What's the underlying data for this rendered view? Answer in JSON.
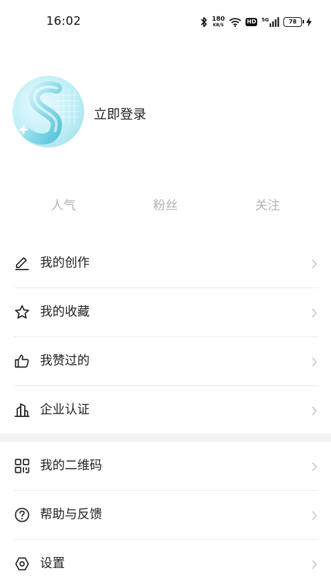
{
  "status_bar": {
    "time": "16:02",
    "net_speed_value": "180",
    "net_speed_unit": "KB/S",
    "hd": "HD",
    "signal_type": "5G",
    "battery": "78",
    "icons": [
      "bluetooth-icon",
      "wifi-icon",
      "hd-icon",
      "cell-signal-icon",
      "battery-icon",
      "charging-icon"
    ]
  },
  "profile": {
    "login_label": "立即登录"
  },
  "stats": [
    {
      "label": "人气"
    },
    {
      "label": "粉丝"
    },
    {
      "label": "关注"
    }
  ],
  "menu_primary": [
    {
      "label": "我的创作",
      "icon": "pencil-icon"
    },
    {
      "label": "我的收藏",
      "icon": "star-icon"
    },
    {
      "label": "我赞过的",
      "icon": "thumbs-up-icon"
    },
    {
      "label": "企业认证",
      "icon": "building-icon"
    }
  ],
  "menu_secondary": [
    {
      "label": "我的二维码",
      "icon": "qr-code-icon"
    },
    {
      "label": "帮助与反馈",
      "icon": "help-icon"
    },
    {
      "label": "设置",
      "icon": "settings-icon"
    }
  ],
  "colors": {
    "text": "#1f1f1f",
    "stat_text": "#b4b4b4",
    "divider": "#ebebeb",
    "section_bg": "#f3f3f3",
    "avatar_accent": "#8fdcea"
  }
}
